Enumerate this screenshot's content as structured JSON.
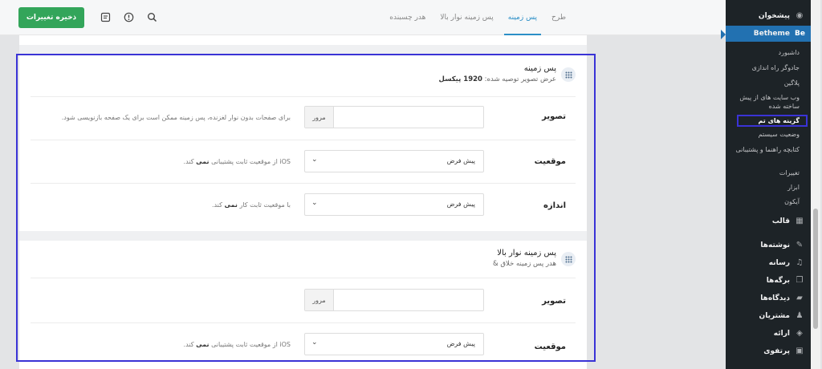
{
  "header": {
    "save_label": "ذخیره تغییرات",
    "tabs": [
      "طرح",
      "پس زمینه",
      "پس زمینه نوار بالا",
      "هدر چسبنده"
    ],
    "active_tab": "پس زمینه"
  },
  "sidebar": {
    "dashboard": "پیشخوان",
    "betheme": "Betheme",
    "brand": "Be",
    "submenu": [
      "داشبورد",
      "جادوگر راه اندازی",
      "پلاگین",
      "وب سایت های از پیش ساخته شده",
      "گزینه های تم",
      "وضعیت سیستم",
      "کتابچه راهنما و پشتیبانی",
      "تغییرات",
      "ابزار",
      "آیکون"
    ],
    "current_submenu": "گزینه های تم",
    "menu": [
      "قالب",
      "نوشته‌ها",
      "رسانه",
      "برگه‌ها",
      "دیدگاه‌ها",
      "مشتریان",
      "ارائه",
      "پرتفوی"
    ]
  },
  "section1": {
    "title": "پس زمینه",
    "sub_prefix": "عرض تصویر توصیه شده:",
    "sub_value": "1920 پیکسل",
    "image_label": "تصویر",
    "browse": "مرور",
    "image_desc": "برای صفحات بدون نوار لغزنده، پس زمینه ممکن است برای یک صفحه بازنویسی شود.",
    "position_label": "موقعیت",
    "position_value": "پیش فرض",
    "position_desc_a": "iOS از موقعیت ثابت پشتیبانی",
    "position_desc_b": "نمی",
    "position_desc_c": "کند.",
    "size_label": "اندازه",
    "size_value": "پیش فرض",
    "size_desc_a": "با موقعیت ثابت کار",
    "size_desc_b": "نمی",
    "size_desc_c": "کند."
  },
  "section2": {
    "title": "پس زمینه نوار بالا",
    "sub": "& هدر پس زمینه خلاق",
    "image_label": "تصویر",
    "browse": "مرور",
    "position_label": "موقعیت",
    "position_value": "پیش فرض",
    "position_desc_a": "iOS از موقعیت ثابت پشتیبانی",
    "position_desc_b": "نمی",
    "position_desc_c": "کند."
  }
}
